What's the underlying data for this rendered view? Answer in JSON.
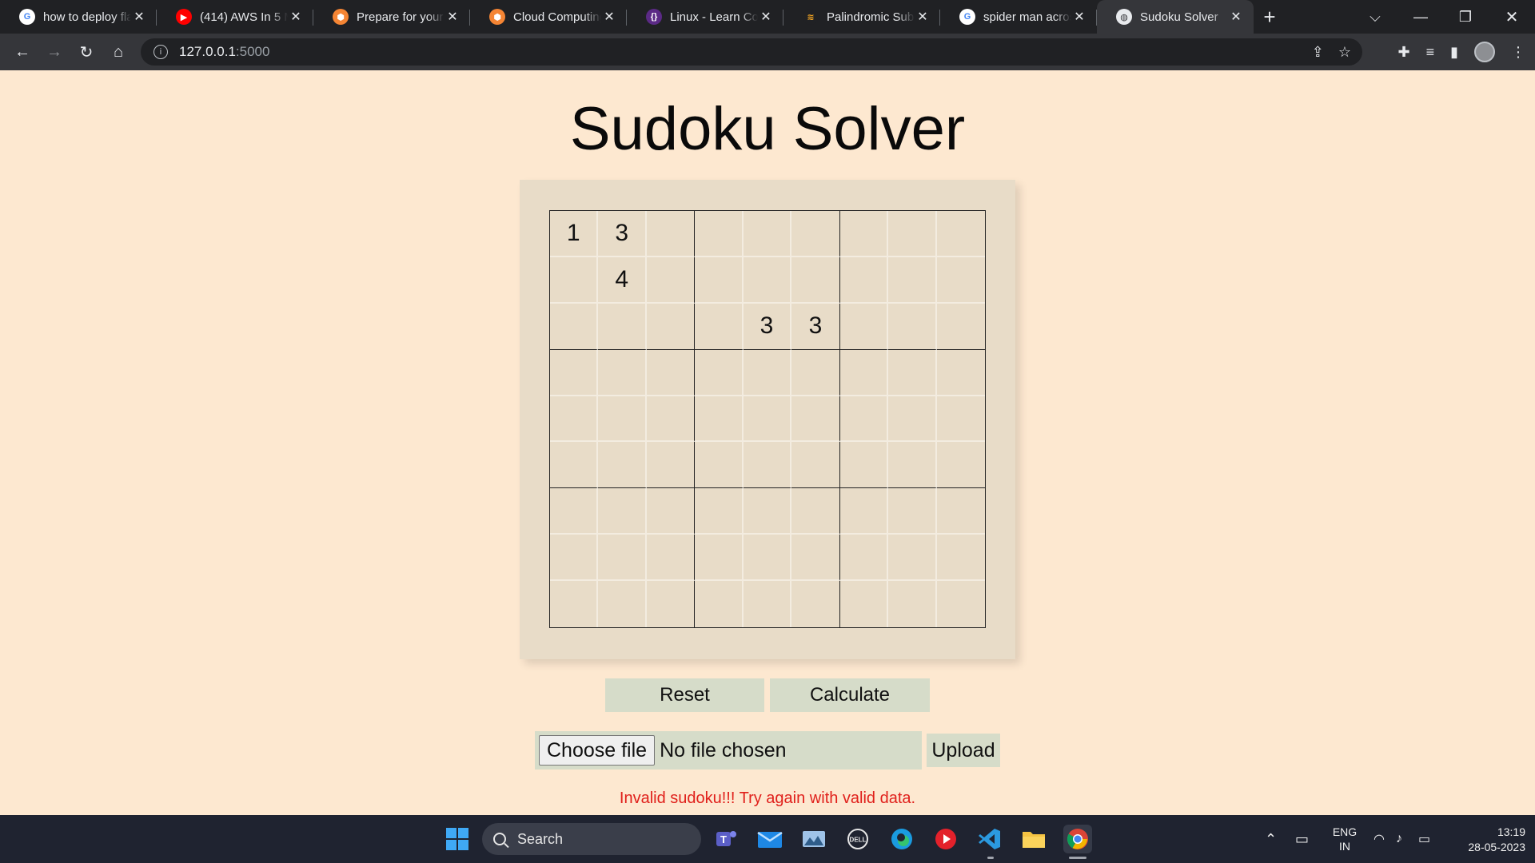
{
  "browser": {
    "tabs": [
      {
        "title": "how to deploy fla",
        "favicon": "google-icon",
        "active": false
      },
      {
        "title": "(414) AWS In 5 Mi",
        "favicon": "youtube-icon",
        "active": false
      },
      {
        "title": "Prepare for your /",
        "favicon": "aws-cube-icon",
        "active": false
      },
      {
        "title": "Cloud Computing",
        "favicon": "aws-cube-icon",
        "active": false
      },
      {
        "title": "Linux - Learn Cod",
        "favicon": "code-brackets-icon",
        "active": false
      },
      {
        "title": "Palindromic Subst",
        "favicon": "palindrome-icon",
        "active": false
      },
      {
        "title": "spider man acros",
        "favicon": "google-icon",
        "active": false
      },
      {
        "title": "Sudoku Solver",
        "favicon": "globe-icon",
        "active": true
      }
    ],
    "url_host": "127.0.0.1",
    "url_port": ":5000"
  },
  "page": {
    "title": "Sudoku Solver",
    "grid": [
      [
        "1",
        "3",
        "",
        "",
        "",
        "",
        "",
        "",
        ""
      ],
      [
        "",
        "4",
        "",
        "",
        "",
        "",
        "",
        "",
        ""
      ],
      [
        "",
        "",
        "",
        "",
        "3",
        "3",
        "",
        "",
        ""
      ],
      [
        "",
        "",
        "",
        "",
        "",
        "",
        "",
        "",
        ""
      ],
      [
        "",
        "",
        "",
        "",
        "",
        "",
        "",
        "",
        ""
      ],
      [
        "",
        "",
        "",
        "",
        "",
        "",
        "",
        "",
        ""
      ],
      [
        "",
        "",
        "",
        "",
        "",
        "",
        "",
        "",
        ""
      ],
      [
        "",
        "",
        "",
        "",
        "",
        "",
        "",
        "",
        ""
      ],
      [
        "",
        "",
        "",
        "",
        "",
        "",
        "",
        "",
        ""
      ]
    ],
    "reset_label": "Reset",
    "calculate_label": "Calculate",
    "choose_file_label": "Choose file",
    "no_file_label": "No file chosen",
    "upload_label": "Upload",
    "error_message": "Invalid sudoku!!! Try again with valid data."
  },
  "taskbar": {
    "search_label": "Search",
    "lang_top": "ENG",
    "lang_bottom": "IN",
    "time": "13:19",
    "date": "28-05-2023",
    "apps": [
      "windows-start-icon",
      "teams-icon",
      "mail-icon",
      "photos-icon",
      "dell-icon",
      "edge-icon",
      "media-player-icon",
      "vscode-icon",
      "file-explorer-icon",
      "chrome-icon"
    ]
  },
  "colors": {
    "page_bg": "#fde8d0",
    "board_bg": "#e8dcc8",
    "button_bg": "#d6dcc9",
    "error_text": "#e0201b"
  }
}
